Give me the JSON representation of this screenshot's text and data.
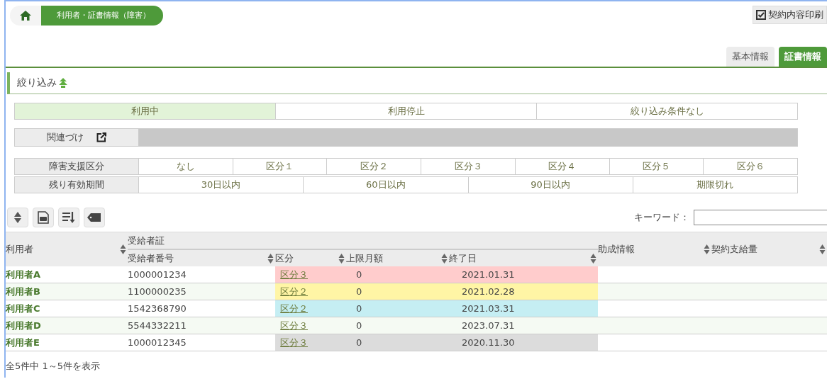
{
  "breadcrumb": {
    "label": "利用者・証書情報（障害）"
  },
  "print_button": {
    "label": "契約内容印刷"
  },
  "tabs": [
    {
      "label": "基本情報",
      "selected": false
    },
    {
      "label": "証書情報",
      "selected": true
    }
  ],
  "filter_section": {
    "title": "絞り込み"
  },
  "status_filters": [
    {
      "label": "利用中",
      "selected": true
    },
    {
      "label": "利用停止",
      "selected": false
    },
    {
      "label": "絞り込み条件なし",
      "selected": false
    }
  ],
  "link_row": {
    "label": "関連づけ"
  },
  "filter_rows": [
    {
      "label": "障害支援区分",
      "options": [
        {
          "label": "なし",
          "selected": false
        },
        {
          "label": "区分１",
          "selected": false
        },
        {
          "label": "区分２",
          "selected": false
        },
        {
          "label": "区分３",
          "selected": false
        },
        {
          "label": "区分４",
          "selected": false
        },
        {
          "label": "区分５",
          "selected": false
        },
        {
          "label": "区分６",
          "selected": false
        }
      ]
    },
    {
      "label": "残り有効期間",
      "options": [
        {
          "label": "30日以内",
          "selected": false
        },
        {
          "label": "60日以内",
          "selected": false
        },
        {
          "label": "90日以内",
          "selected": false
        },
        {
          "label": "期限切れ",
          "selected": false
        }
      ]
    }
  ],
  "keyword": {
    "label": "キーワード："
  },
  "table": {
    "group_header": "受給者証",
    "columns": [
      {
        "label": "利用者",
        "kind": "span"
      },
      {
        "label": "受給者番号",
        "kind": "group"
      },
      {
        "label": "区分",
        "kind": "group"
      },
      {
        "label": "上限月額",
        "kind": "group"
      },
      {
        "label": "終了日",
        "kind": "group"
      },
      {
        "label": "助成情報",
        "kind": "span"
      },
      {
        "label": "契約支給量",
        "kind": "span"
      }
    ],
    "rows": [
      {
        "user": "利用者A",
        "number": "1000001234",
        "category": "区分３",
        "limit": "0",
        "end_date": "2021.01.31",
        "color": "#ffcccc"
      },
      {
        "user": "利用者B",
        "number": "1100000235",
        "category": "区分２",
        "limit": "0",
        "end_date": "2021.02.28",
        "color": "#fff5a5"
      },
      {
        "user": "利用者C",
        "number": "1542368790",
        "category": "区分２",
        "limit": "0",
        "end_date": "2021.03.31",
        "color": "#c5eef3"
      },
      {
        "user": "利用者D",
        "number": "5544332211",
        "category": "区分３",
        "limit": "0",
        "end_date": "2023.07.31"
      },
      {
        "user": "利用者E",
        "number": "1000012345",
        "category": "区分３",
        "limit": "0",
        "end_date": "2020.11.30",
        "color": "#dcdcdc"
      }
    ]
  },
  "footer": "全5件中 1～5件を表示"
}
